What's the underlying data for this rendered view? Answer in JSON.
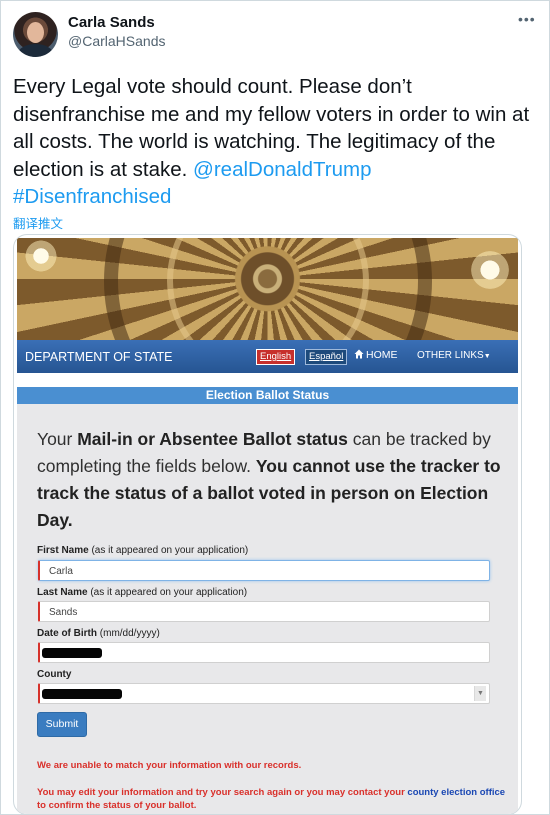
{
  "tweet": {
    "author_name": "Carla Sands",
    "author_handle": "@CarlaHSands",
    "text_main": "Every Legal vote should count.  Please don’t disenfranchise me and my fellow voters in order to win at all costs.  The world is watching.  The legitimacy of the election is at stake. ",
    "mention": "@realDonaldTrump",
    "hashtag": "#Disenfranchised",
    "translate_label": "翻译推文"
  },
  "embedded_page": {
    "nav": {
      "department": "DEPARTMENT OF STATE",
      "lang_english": "English",
      "lang_espanol": "Español",
      "home": "HOME",
      "other_links": "OTHER LINKS"
    },
    "status_title": "Election Ballot Status",
    "intro": {
      "p1": "Your ",
      "p1_bold": "Mail-in or Absentee Ballot status",
      "p2": " can be tracked by completing the fields below. ",
      "p2_bold": "You cannot use the tracker to track the status of a ballot voted in person on Election Day."
    },
    "fields": {
      "first_name_label": "First Name",
      "first_name_hint": " (as it appeared on your application)",
      "first_name_value": "Carla",
      "last_name_label": "Last Name",
      "last_name_hint": " (as it appeared on your application)",
      "last_name_value": "Sands",
      "dob_label": "Date of Birth",
      "dob_hint": " (mm/dd/yyyy)",
      "county_label": "County"
    },
    "submit_label": "Submit",
    "error1": "We are unable to match your information with our records.",
    "error2_a": "You may edit your information and try your search again or you may contact your ",
    "error2_link": "county election office",
    "error2_b": " to confirm the status of your ballot."
  }
}
